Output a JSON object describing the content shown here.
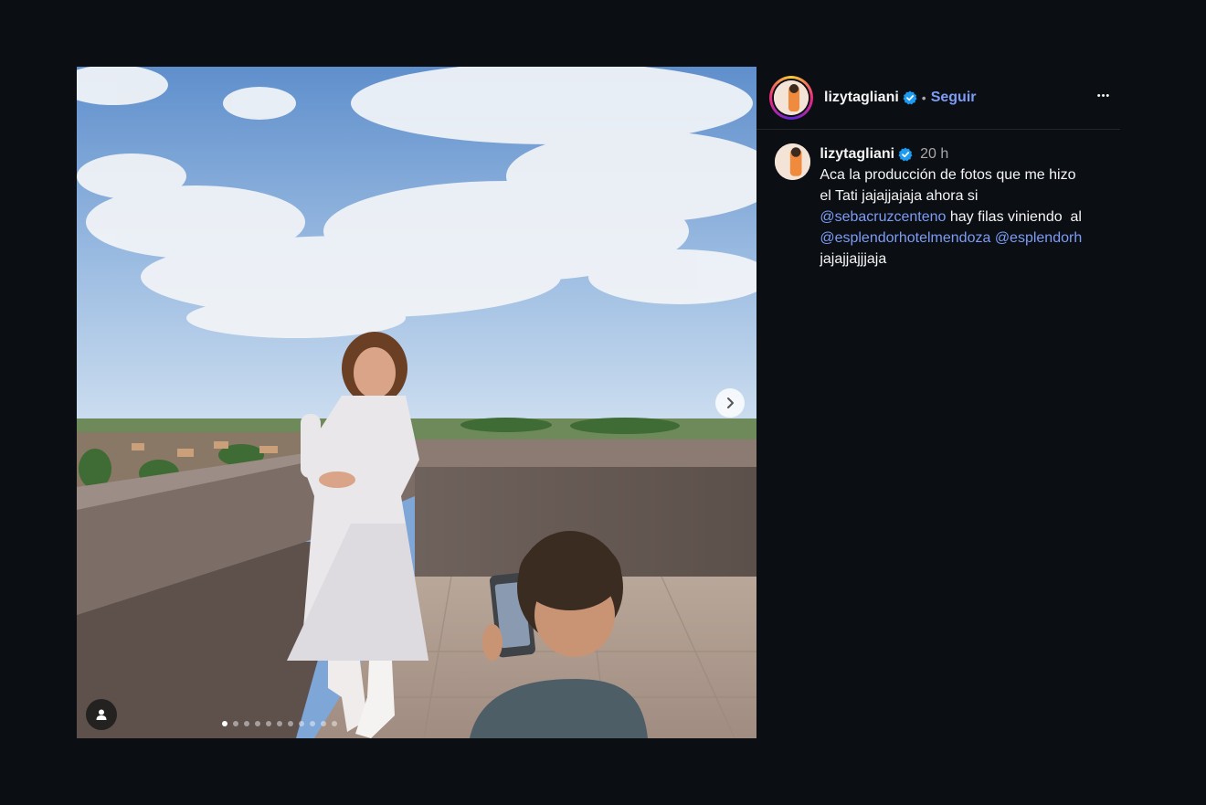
{
  "post": {
    "username": "lizytagliani",
    "separator": "•",
    "follow_label": "Seguir",
    "more_label": "•••",
    "time": "20 h",
    "caption": {
      "line1": "Aca la producción de fotos que me hizo",
      "line2": "el Tati jajajjajaja ahora si",
      "mention1": "@sebacruzcenteno",
      "after_mention1": " hay filas viniendo  al",
      "mention2": "@esplendorhotelmendoza",
      "mention3": "@esplendorh",
      "line_last": "jajajjajjjaja"
    },
    "carousel": {
      "total": 11,
      "current": 1
    }
  },
  "icons": {
    "verified": "verified-badge-icon",
    "next": "chevron-right-icon",
    "tag": "user-tag-icon",
    "more": "more-options-icon"
  },
  "colors": {
    "accent": "#7c9cf5",
    "verified": "#1d9bf0",
    "background": "#0b0e13"
  }
}
